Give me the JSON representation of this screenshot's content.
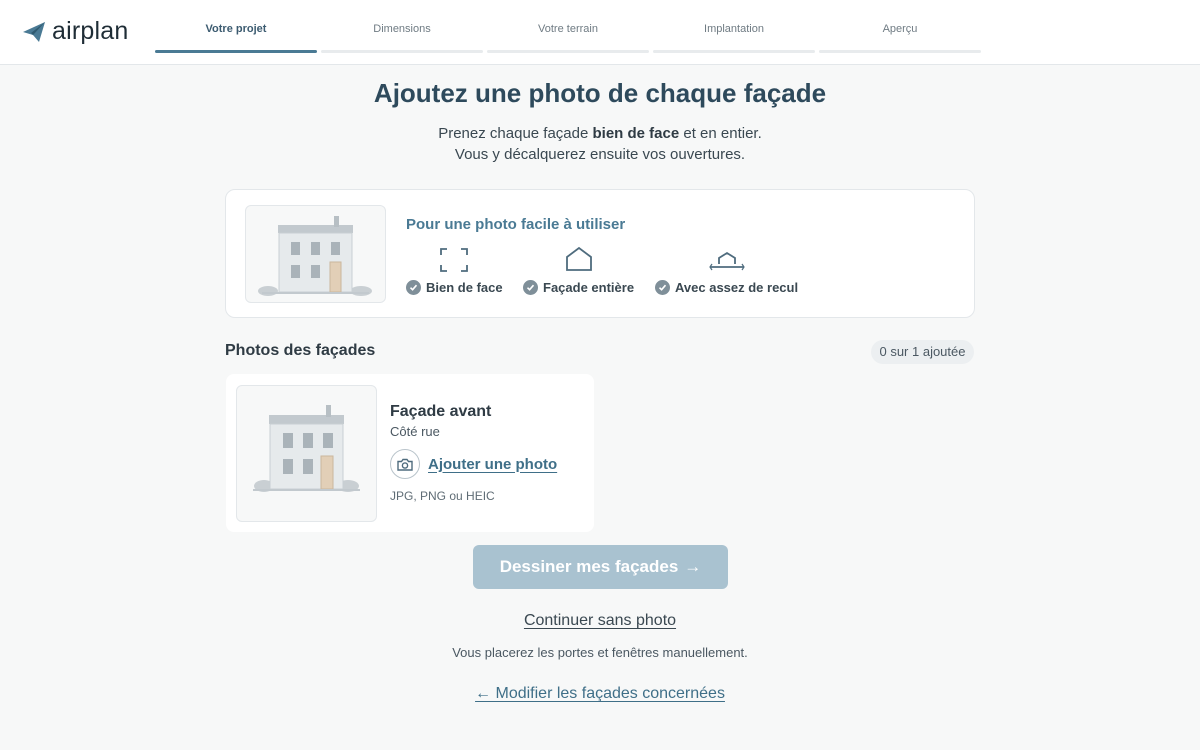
{
  "header": {
    "logo_text": "airplan",
    "steps": [
      {
        "label": "Votre projet",
        "active": true
      },
      {
        "label": "Dimensions",
        "active": false
      },
      {
        "label": "Votre terrain",
        "active": false
      },
      {
        "label": "Implantation",
        "active": false
      },
      {
        "label": "Aperçu",
        "active": false
      }
    ]
  },
  "main": {
    "title": "Ajoutez une photo de chaque façade",
    "subtitle": {
      "line1_before": "Prenez chaque façade ",
      "line1_bold": "bien de face",
      "line1_after": " et en entier.",
      "line2": "Vous y décalquerez ensuite vos ouvertures."
    }
  },
  "tips": {
    "title": "Pour une photo facile à utiliser",
    "items": [
      {
        "label": "Bien de face",
        "icon": "frame-corners-icon"
      },
      {
        "label": "Façade entière",
        "icon": "house-outline-icon"
      },
      {
        "label": "Avec assez de recul",
        "icon": "distance-icon"
      }
    ]
  },
  "photos": {
    "section_title": "Photos des façades",
    "count": "0 sur 1 ajoutée",
    "facades": [
      {
        "title": "Façade avant",
        "subtitle": "Côté rue",
        "add_label": "Ajouter une photo",
        "formats": "JPG, PNG ou HEIC"
      }
    ]
  },
  "actions": {
    "primary": "Dessiner mes façades",
    "primary_arrow": "→",
    "continue": "Continuer sans photo",
    "hint": "Vous placerez les portes et fenêtres manuellement.",
    "back": "← Modifier les façades concernées"
  },
  "colors": {
    "accent": "#4a7a94",
    "primary_disabled": "#a9c2d0",
    "title": "#2e4a5c"
  }
}
